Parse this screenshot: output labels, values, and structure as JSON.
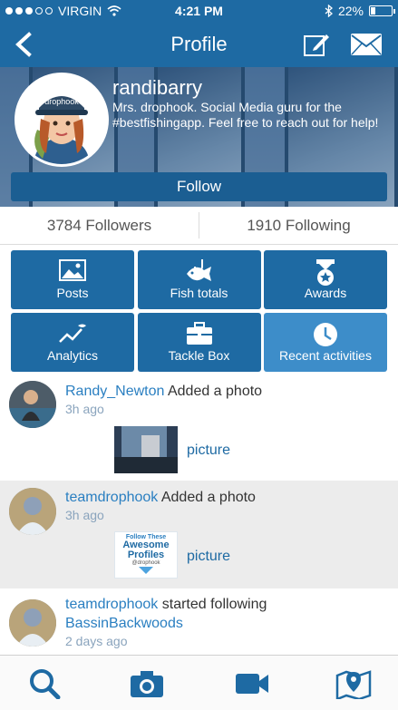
{
  "status_bar": {
    "carrier": "VIRGIN",
    "time": "4:21 PM",
    "battery": "22%",
    "battery_level": 0.22
  },
  "nav": {
    "title": "Profile",
    "icons": [
      "back-chevron-icon",
      "edit-icon",
      "mail-icon"
    ]
  },
  "profile": {
    "username": "randibarry",
    "bio": "Mrs. drophook. Social Media guru for the #bestfishingapp. Feel free to reach out for help!",
    "avatar_cap_text": "drophook",
    "follow_label": "Follow"
  },
  "stats": {
    "followers": "3784 Followers",
    "following": "1910 Following"
  },
  "menu": [
    {
      "label": "Posts",
      "icon": "image-icon"
    },
    {
      "label": "Fish totals",
      "icon": "fish-hook-icon"
    },
    {
      "label": "Awards",
      "icon": "award-medal-icon"
    },
    {
      "label": "Analytics",
      "icon": "analytics-chart-icon"
    },
    {
      "label": "Tackle Box",
      "icon": "tackle-box-icon"
    },
    {
      "label": "Recent activities",
      "icon": "clock-icon",
      "active": true
    }
  ],
  "feed": [
    {
      "user": "Randy_Newton",
      "action": "Added a photo",
      "when": "3h ago",
      "attachment": "picture"
    },
    {
      "user": "teamdrophook",
      "action": "Added a photo",
      "when": "3h ago",
      "attachment": "picture",
      "thumb_text": [
        "Follow These",
        "Awesome",
        "Profiles",
        "@drophook"
      ]
    },
    {
      "user": "teamdrophook",
      "action": "started following",
      "target": "BassinBackwoods",
      "when": "2 days ago"
    }
  ],
  "tabbar": [
    "search-icon",
    "camera-icon",
    "video-camera-icon",
    "map-pin-icon"
  ],
  "colors": {
    "primary": "#1e6aa3",
    "active_tile": "#3d8dc9",
    "link": "#2a7fc1",
    "muted": "#8aa4bd"
  }
}
